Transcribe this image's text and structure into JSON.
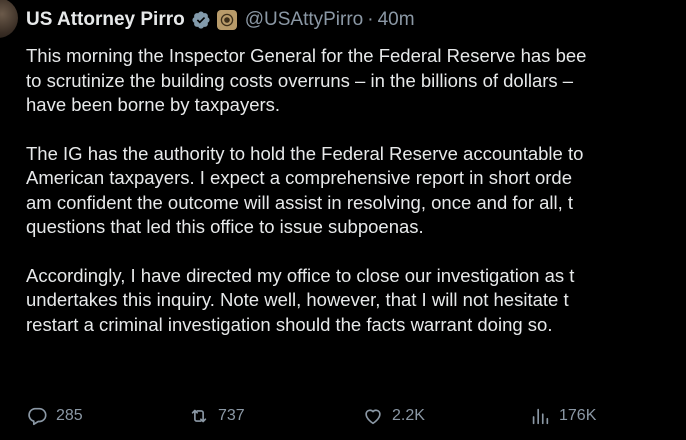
{
  "post": {
    "author_name": "US Attorney Pirro",
    "handle": "@USAttyPirro",
    "separator": "·",
    "time": "40m",
    "paragraphs": [
      {
        "lines": [
          "This morning the Inspector General for the Federal Reserve has bee",
          "to scrutinize the building costs overruns – in the billions of dollars –",
          "have been borne by taxpayers."
        ]
      },
      {
        "lines": [
          "The IG has the authority to hold the Federal Reserve accountable to",
          "American taxpayers.  I expect a comprehensive report in short orde",
          "am confident the outcome will assist in resolving, once and for all, t",
          "questions that led this office to issue subpoenas."
        ]
      },
      {
        "lines": [
          "Accordingly, I have directed my office to close our investigation as t",
          "undertakes this inquiry.  Note well, however, that I will not hesitate t",
          "restart a criminal investigation should the facts warrant doing so."
        ]
      }
    ]
  },
  "actions": {
    "reply_count": "285",
    "repost_count": "737",
    "like_count": "2.2K",
    "views_count": "176K"
  },
  "icons": {
    "avatar": "avatar",
    "verified": "verified-badge-icon",
    "government": "government-seal-icon",
    "reply": "reply-icon",
    "repost": "repost-icon",
    "like": "heart-icon",
    "views": "views-icon"
  },
  "colors": {
    "background": "#000000",
    "text": "#e7e9ea",
    "secondary": "#8b98a5",
    "verified": "#829aab",
    "gov_badge": "#b89b6a"
  }
}
